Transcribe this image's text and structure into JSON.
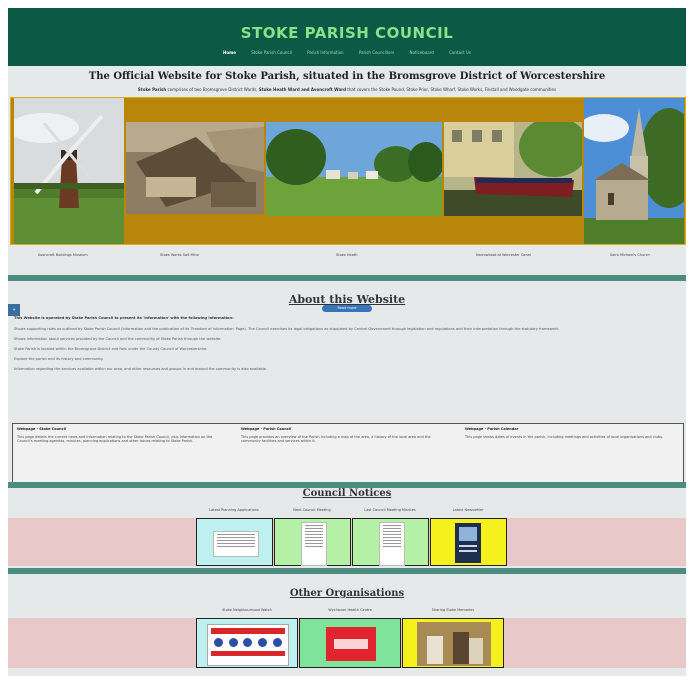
{
  "header": {
    "title": "STOKE PARISH COUNCIL",
    "nav": [
      "Home",
      "Stoke Parish Council",
      "Parish Information",
      "Parish Councillors",
      "Noticeboard",
      "Contact Us"
    ]
  },
  "subtitle": "The Official Website for Stoke Parish, situated in the Bromsgrove District of Worcestershire",
  "intro": {
    "lead": "Stoke Parish",
    "text1": " comprises of two Bromsgrove District Wards, ",
    "wards": "Stoke Heath Ward and Avoncroft Ward",
    "text2": " that covers the Stoke Pound, Stoke Prior, Stoke Wharf, Stoke Works, Finstall and Woodgate communities"
  },
  "banner_captions": [
    "Avoncroft Buildings Museum",
    "Stoke Works Salt Mine",
    "Stoke Heath",
    "Narrowboat at Worcester Canal",
    "Saint Michael's Church"
  ],
  "about": {
    "heading": "About this Website",
    "button": "Read more",
    "paragraphs": [
      "This Website is operated by Stoke Parish Council to present its 'Information' with the following information:",
      "Shows supporting roles as outlined by Stoke Parish Council (information and the publication of its 'Freedom of Information' Page). The Council exercises its legal obligations as stipulated by Central Government through legislation and regulations and their interpretation through the statutory framework.",
      "Shows information about services provided by the Council and the community of Stoke Parish through the website.",
      "Stoke Parish is located within the Bromsgrove District and falls under the County Council of Worcestershire.",
      "Explore the parish and its history and community.",
      "Information regarding the services available within our area, and other resources and groups in and around the community is also available."
    ]
  },
  "webpage_boxes": [
    {
      "title": "Webpage - Stoke Council",
      "text": "This page details the current news and information relating to the Stoke Parish Council, plus information on the Council's meeting agendas, minutes, planning applications and other issues relating to Stoke Parish."
    },
    {
      "title": "Webpage - Parish Council",
      "text": "This page provides an overview of the Parish including a map of the area, a history of the local area and the community facilities and services within it."
    },
    {
      "title": "Webpage - Parish Calendar",
      "text": "This page shows dates of events in the parish, including meetings and activities of local organisations and clubs."
    }
  ],
  "notices": {
    "heading": "Council Notices",
    "tiles": [
      {
        "label": "Latest Planning Applications",
        "color": "#bff0f0"
      },
      {
        "label": "Next Council Meeting",
        "color": "#b5f0a7"
      },
      {
        "label": "Last Council Meeting Minutes",
        "color": "#b5f0a7"
      },
      {
        "label": "Latest Newsletter",
        "color": "#f5f11d"
      }
    ]
  },
  "organisations": {
    "heading": "Other Organisations",
    "tiles": [
      {
        "label": "Stoke Neighbourhood Watch",
        "color": "#bff0f0"
      },
      {
        "label": "Wychavon Health Centre",
        "color": "#b5f0a7"
      },
      {
        "label": "Sharing Stoke Memories",
        "color": "#f5f11d"
      }
    ]
  },
  "colors": {
    "header_bg": "#0c5a45",
    "title_green": "#8be08a",
    "banner_gold": "#b7860b",
    "divider": "#4d8d80",
    "band_pink": "#e8c8c8"
  }
}
